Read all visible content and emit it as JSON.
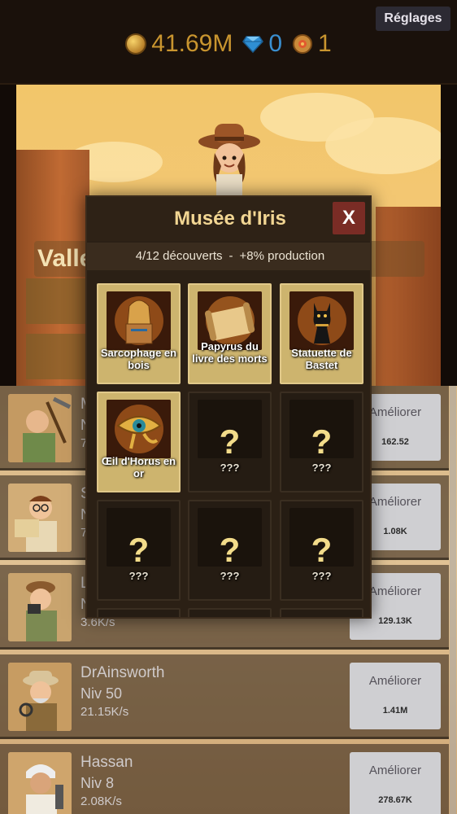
{
  "topbar": {
    "settings_label": "Réglages",
    "gold": "41.69M",
    "gems": "0",
    "relics": "1"
  },
  "scene": {
    "title_partial": "Valle"
  },
  "modal": {
    "title": "Musée d'Iris",
    "close_label": "X",
    "progress": "4/12 découverts",
    "separator": "-",
    "bonus": "+8% production",
    "artifacts": [
      {
        "name": "Sarcophage en bois",
        "found": true
      },
      {
        "name": "Papyrus du livre des morts",
        "found": true
      },
      {
        "name": "Statuette de Bastet",
        "found": true
      },
      {
        "name": "Œil d'Horus en or",
        "found": true
      },
      {
        "name": "???",
        "found": false,
        "mark": "?"
      },
      {
        "name": "???",
        "found": false,
        "mark": "?"
      },
      {
        "name": "???",
        "found": false,
        "mark": "?"
      },
      {
        "name": "???",
        "found": false,
        "mark": "?"
      },
      {
        "name": "???",
        "found": false,
        "mark": "?"
      }
    ]
  },
  "workers": [
    {
      "name": "M",
      "level": "N",
      "rate": "7",
      "upgrade_label": "Améliorer",
      "cost": "162.52"
    },
    {
      "name": "S",
      "level": "N",
      "rate": "7",
      "upgrade_label": "Améliorer",
      "cost": "1.08K"
    },
    {
      "name": "L",
      "level": "N",
      "rate": "3.6K/s",
      "upgrade_label": "Améliorer",
      "cost": "129.13K"
    },
    {
      "name": "DrAinsworth",
      "level": "Niv 50",
      "rate": "21.15K/s",
      "upgrade_label": "Améliorer",
      "cost": "1.41M"
    },
    {
      "name": "Hassan",
      "level": "Niv 8",
      "rate": "2.08K/s",
      "upgrade_label": "Améliorer",
      "cost": "278.67K"
    }
  ]
}
